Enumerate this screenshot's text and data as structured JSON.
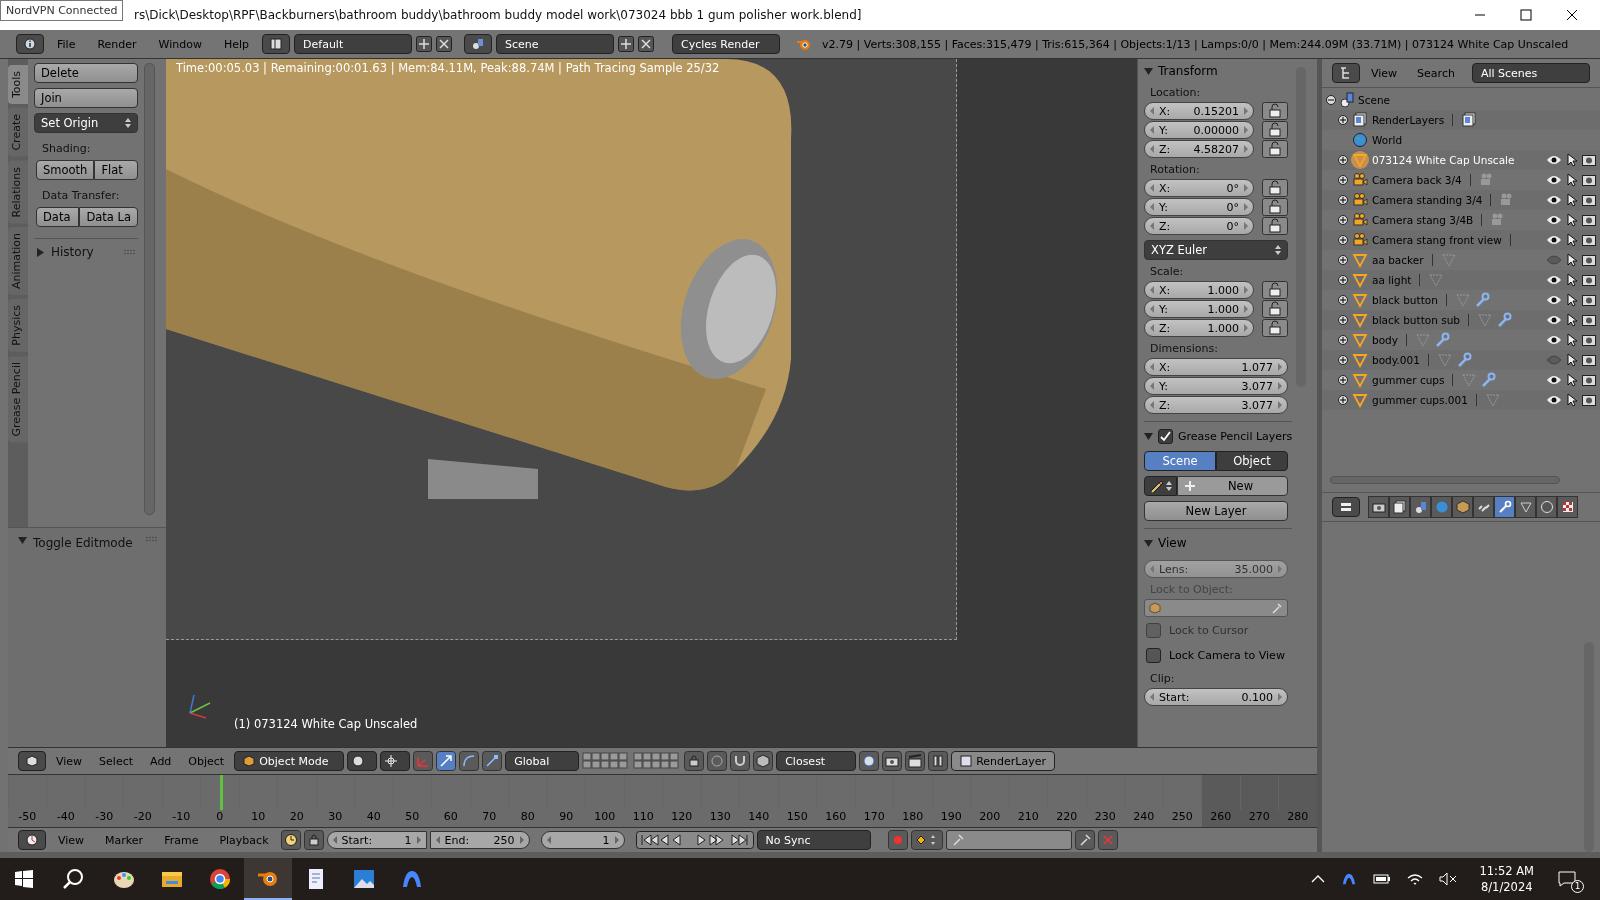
{
  "tooltip": "NordVPN Connected",
  "window": {
    "title": "rs\\Dick\\Desktop\\RPF\\Backburners\\bathroom buddy\\bathroom buddy model work\\073024 bbb 1 gum polisher work.blend]"
  },
  "info_header": {
    "menus": [
      "File",
      "Render",
      "Window",
      "Help"
    ],
    "layout": "Default",
    "scene": "Scene",
    "engine": "Cycles Render",
    "stats": "v2.79 | Verts:308,155 | Faces:315,479 | Tris:615,364 | Objects:1/13 | Lamps:0/0 | Mem:244.09M (33.71M) | 073124 White Cap Unscaled"
  },
  "tool_tabs": [
    {
      "label": "Tools",
      "selected": true
    },
    {
      "label": "Create",
      "selected": false
    },
    {
      "label": "Relations",
      "selected": false
    },
    {
      "label": "Animation",
      "selected": false
    },
    {
      "label": "Physics",
      "selected": false
    },
    {
      "label": "Grease Pencil",
      "selected": false
    }
  ],
  "tool_panel": {
    "buttons": [
      {
        "label": "Delete",
        "kind": "button"
      },
      {
        "label": "Join",
        "kind": "button"
      },
      {
        "label": "Set Origin",
        "kind": "dropdown"
      }
    ],
    "groups": [
      {
        "label": "Shading:",
        "buttons": [
          "Smooth",
          "Flat"
        ]
      },
      {
        "label": "Data Transfer:",
        "buttons": [
          "Data",
          "Data La"
        ]
      }
    ],
    "history": {
      "label": "History",
      "expanded": false
    }
  },
  "operator_panel": {
    "label": "Toggle Editmode",
    "expanded": true
  },
  "viewport": {
    "render_info": "Time:00:05.03 | Remaining:00:01.63 | Mem:84.11M, Peak:88.74M | Path Tracing Sample 25/32",
    "object_label": "(1) 073124 White Cap Unscaled"
  },
  "transform": {
    "title": "Transform",
    "expanded": true,
    "groups": [
      {
        "label": "Location:",
        "locks": true,
        "fields": [
          {
            "axis": "X:",
            "value": "0.15201"
          },
          {
            "axis": "Y:",
            "value": "0.00000"
          },
          {
            "axis": "Z:",
            "value": "4.58207"
          }
        ]
      },
      {
        "label": "Rotation:",
        "locks": true,
        "fields": [
          {
            "axis": "X:",
            "value": "0°"
          },
          {
            "axis": "Y:",
            "value": "0°"
          },
          {
            "axis": "Z:",
            "value": "0°"
          }
        ],
        "mode": "XYZ Euler"
      },
      {
        "label": "Scale:",
        "locks": true,
        "fields": [
          {
            "axis": "X:",
            "value": "1.000"
          },
          {
            "axis": "Y:",
            "value": "1.000"
          },
          {
            "axis": "Z:",
            "value": "1.000"
          }
        ]
      },
      {
        "label": "Dimensions:",
        "locks": false,
        "fields": [
          {
            "axis": "X:",
            "value": "1.077"
          },
          {
            "axis": "Y:",
            "value": "3.077"
          },
          {
            "axis": "Z:",
            "value": "3.077"
          }
        ]
      }
    ]
  },
  "grease_pencil": {
    "title": "Grease Pencil Layers",
    "expanded": true,
    "checked": true,
    "tabs": [
      {
        "label": "Scene",
        "selected": true
      },
      {
        "label": "Object",
        "selected": false
      }
    ],
    "new_button": "New",
    "new_layer_button": "New Layer"
  },
  "view_panel": {
    "title": "View",
    "expanded": true,
    "lens_label": "Lens:",
    "lens_value": "35.000",
    "lock_object_label": "Lock to Object:",
    "checkboxes": [
      {
        "label": "Lock to Cursor",
        "checked": false,
        "disabled": true
      },
      {
        "label": "Lock Camera to View",
        "checked": false,
        "disabled": false
      }
    ],
    "clip_label": "Clip:",
    "clip_start_label": "Start:",
    "clip_start_value": "0.100"
  },
  "outliner": {
    "menus": [
      "View",
      "Search"
    ],
    "display": "All Scenes",
    "tree": [
      {
        "name": "Scene",
        "kind": "scene",
        "expanded": true,
        "selected": false,
        "children": [
          {
            "name": "RenderLayers",
            "kind": "renderlayers",
            "expanded": false,
            "selected": false
          },
          {
            "name": "World",
            "kind": "world",
            "selected": false
          },
          {
            "name": "073124 White Cap Unscale",
            "kind": "mesh",
            "expanded": false,
            "selected": true,
            "visible": true,
            "modifier": false
          },
          {
            "name": "Camera back 3/4",
            "kind": "camera",
            "expanded": false,
            "selected": false,
            "visible": true,
            "modifier": false
          },
          {
            "name": "Camera standing 3/4",
            "kind": "camera",
            "expanded": false,
            "selected": false,
            "visible": true,
            "modifier": false
          },
          {
            "name": "Camera stang 3/4B",
            "kind": "camera",
            "expanded": false,
            "selected": false,
            "visible": true,
            "modifier": false
          },
          {
            "name": "Camera stang front view",
            "kind": "camera",
            "expanded": false,
            "selected": false,
            "visible": true,
            "modifier": false
          },
          {
            "name": "aa backer",
            "kind": "mesh",
            "expanded": false,
            "selected": false,
            "visible": false,
            "modifier": false
          },
          {
            "name": "aa light",
            "kind": "mesh",
            "expanded": false,
            "selected": false,
            "visible": true,
            "modifier": false
          },
          {
            "name": "black button",
            "kind": "mesh",
            "expanded": false,
            "selected": false,
            "visible": true,
            "modifier": true
          },
          {
            "name": "black button sub",
            "kind": "mesh",
            "expanded": false,
            "selected": false,
            "visible": true,
            "modifier": true
          },
          {
            "name": "body",
            "kind": "mesh",
            "expanded": false,
            "selected": false,
            "visible": true,
            "modifier": true
          },
          {
            "name": "body.001",
            "kind": "mesh",
            "expanded": false,
            "selected": false,
            "visible": false,
            "modifier": true
          },
          {
            "name": "gummer cups",
            "kind": "mesh",
            "expanded": false,
            "selected": false,
            "visible": true,
            "modifier": true
          },
          {
            "name": "gummer cups.001",
            "kind": "mesh",
            "expanded": false,
            "selected": false,
            "visible": true,
            "modifier": false
          }
        ]
      }
    ]
  },
  "properties_tabs": [
    {
      "kind": "render",
      "selected": false
    },
    {
      "kind": "renderlayers",
      "selected": false
    },
    {
      "kind": "scene",
      "selected": false
    },
    {
      "kind": "world",
      "selected": false
    },
    {
      "kind": "object",
      "selected": false
    },
    {
      "kind": "constraints",
      "selected": false
    },
    {
      "kind": "modifiers",
      "selected": true
    },
    {
      "kind": "data",
      "selected": false
    },
    {
      "kind": "material",
      "selected": false
    },
    {
      "kind": "texture",
      "selected": false
    }
  ],
  "view3d_header": {
    "menus": [
      "View",
      "Select",
      "Add",
      "Object"
    ],
    "mode": "Object Mode",
    "orientation": "Global",
    "snap": "Closest",
    "layer": "RenderLayer"
  },
  "timeline": {
    "ticks": [
      {
        "label": "-50",
        "current": false,
        "shaded": false
      },
      {
        "label": "-40",
        "current": false,
        "shaded": false
      },
      {
        "label": "-30",
        "current": false,
        "shaded": false
      },
      {
        "label": "-20",
        "current": false,
        "shaded": false
      },
      {
        "label": "-10",
        "current": false,
        "shaded": false
      },
      {
        "label": "0",
        "current": true,
        "shaded": false
      },
      {
        "label": "10",
        "current": false,
        "shaded": false
      },
      {
        "label": "20",
        "current": false,
        "shaded": false
      },
      {
        "label": "30",
        "current": false,
        "shaded": false
      },
      {
        "label": "40",
        "current": false,
        "shaded": false
      },
      {
        "label": "50",
        "current": false,
        "shaded": false
      },
      {
        "label": "60",
        "current": false,
        "shaded": false
      },
      {
        "label": "70",
        "current": false,
        "shaded": false
      },
      {
        "label": "80",
        "current": false,
        "shaded": false
      },
      {
        "label": "90",
        "current": false,
        "shaded": false
      },
      {
        "label": "100",
        "current": false,
        "shaded": false
      },
      {
        "label": "110",
        "current": false,
        "shaded": false
      },
      {
        "label": "120",
        "current": false,
        "shaded": false
      },
      {
        "label": "130",
        "current": false,
        "shaded": false
      },
      {
        "label": "140",
        "current": false,
        "shaded": false
      },
      {
        "label": "150",
        "current": false,
        "shaded": false
      },
      {
        "label": "160",
        "current": false,
        "shaded": false
      },
      {
        "label": "170",
        "current": false,
        "shaded": false
      },
      {
        "label": "180",
        "current": false,
        "shaded": false
      },
      {
        "label": "190",
        "current": false,
        "shaded": false
      },
      {
        "label": "200",
        "current": false,
        "shaded": false
      },
      {
        "label": "210",
        "current": false,
        "shaded": false
      },
      {
        "label": "220",
        "current": false,
        "shaded": false
      },
      {
        "label": "230",
        "current": false,
        "shaded": false
      },
      {
        "label": "240",
        "current": false,
        "shaded": false
      },
      {
        "label": "250",
        "current": false,
        "shaded": false
      },
      {
        "label": "260",
        "current": false,
        "shaded": true
      },
      {
        "label": "270",
        "current": false,
        "shaded": true
      },
      {
        "label": "280",
        "current": false,
        "shaded": true
      }
    ]
  },
  "timeline_header": {
    "menus": [
      "View",
      "Marker",
      "Frame",
      "Playback"
    ],
    "start_label": "Start:",
    "start": "1",
    "end_label": "End:",
    "end": "250",
    "frame": "1",
    "sync": "No Sync"
  },
  "taskbar": {
    "apps": [
      {
        "kind": "paint",
        "selected": false
      },
      {
        "kind": "folder",
        "selected": false
      },
      {
        "kind": "chrome",
        "selected": false
      },
      {
        "kind": "blender",
        "selected": true
      },
      {
        "kind": "document",
        "selected": false
      },
      {
        "kind": "photos",
        "selected": false
      },
      {
        "kind": "vpn",
        "selected": false
      }
    ],
    "time": "11:52 AM",
    "date": "8/1/2024",
    "notifications": "1"
  }
}
